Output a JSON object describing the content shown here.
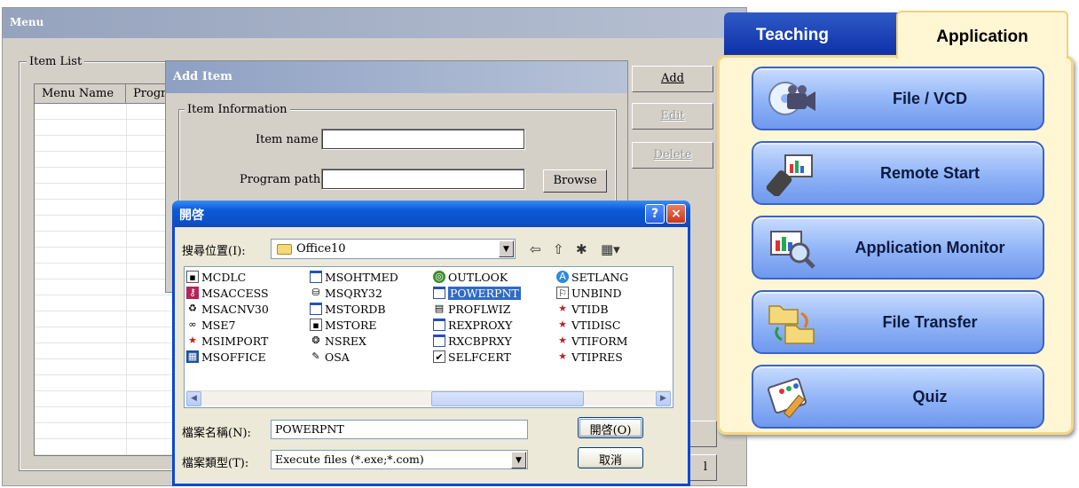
{
  "menu_window": {
    "title": "Menu",
    "item_list_label": "Item List",
    "columns": [
      "Menu Name",
      "Progra"
    ],
    "buttons": {
      "add": "Add",
      "edit": "Edit",
      "delete": "Delete",
      "partial": "l"
    }
  },
  "add_item_dialog": {
    "title": "Add Item",
    "group_label": "Item Information",
    "item_name_label": "Item name",
    "item_name_value": "",
    "program_path_label": "Program path",
    "program_path_value": "",
    "browse_label": "Browse"
  },
  "open_dialog": {
    "title": "開啓",
    "help_glyph": "?",
    "close_glyph": "×",
    "look_in_label": "搜尋位置(I):",
    "look_in_value": "Office10",
    "files": [
      {
        "name": "MCDLC",
        "icon": "app-icon"
      },
      {
        "name": "MSACCESS",
        "icon": "access-icon"
      },
      {
        "name": "MSACNV30",
        "icon": "convert-icon"
      },
      {
        "name": "MSE7",
        "icon": "script-editor-icon"
      },
      {
        "name": "MSIMPORT",
        "icon": "star-icon"
      },
      {
        "name": "MSOFFICE",
        "icon": "office-icon"
      },
      {
        "name": "MSOHTMED",
        "icon": "window-icon"
      },
      {
        "name": "MSQRY32",
        "icon": "query-icon"
      },
      {
        "name": "MSTORDB",
        "icon": "window-icon"
      },
      {
        "name": "MSTORE",
        "icon": "app-icon"
      },
      {
        "name": "NSREX",
        "icon": "network-icon"
      },
      {
        "name": "OSA",
        "icon": "osa-icon"
      },
      {
        "name": "OUTLOOK",
        "icon": "outlook-icon"
      },
      {
        "name": "POWERPNT",
        "icon": "powerpoint-icon",
        "selected": true
      },
      {
        "name": "PROFLWIZ",
        "icon": "wizard-icon"
      },
      {
        "name": "REXPROXY",
        "icon": "window-icon"
      },
      {
        "name": "RXCBPRXY",
        "icon": "window-icon"
      },
      {
        "name": "SELFCERT",
        "icon": "certificate-icon"
      },
      {
        "name": "SETLANG",
        "icon": "language-icon"
      },
      {
        "name": "UNBIND",
        "icon": "unbind-icon"
      },
      {
        "name": "VTIDB",
        "icon": "star-icon"
      },
      {
        "name": "VTIDISC",
        "icon": "star-icon"
      },
      {
        "name": "VTIFORM",
        "icon": "star-icon"
      },
      {
        "name": "VTIPRES",
        "icon": "star-icon"
      }
    ],
    "filename_label": "檔案名稱(N):",
    "filename_value": "POWERPNT",
    "filetype_label": "檔案類型(T):",
    "filetype_value": "Execute files (*.exe;*.com)",
    "open_button": "開啓(O)",
    "cancel_button": "取消"
  },
  "right_panel": {
    "tabs": [
      {
        "label": "Teaching",
        "active": false
      },
      {
        "label": "Application",
        "active": true
      }
    ],
    "buttons": [
      {
        "label": "File / VCD",
        "icon": "video-camera-icon"
      },
      {
        "label": "Remote Start",
        "icon": "remote-control-icon"
      },
      {
        "label": "Application Monitor",
        "icon": "monitor-chart-icon"
      },
      {
        "label": "File Transfer",
        "icon": "folder-transfer-icon"
      },
      {
        "label": "Quiz",
        "icon": "quiz-pencil-icon"
      }
    ]
  },
  "colors": {
    "xp_title_blue": "#0b5bd8",
    "selection_blue": "#316ac5",
    "panel_cream": "#fff6d4",
    "button_blue": "#8fb3f6",
    "teaching_tab_blue": "#0d2fa6"
  }
}
